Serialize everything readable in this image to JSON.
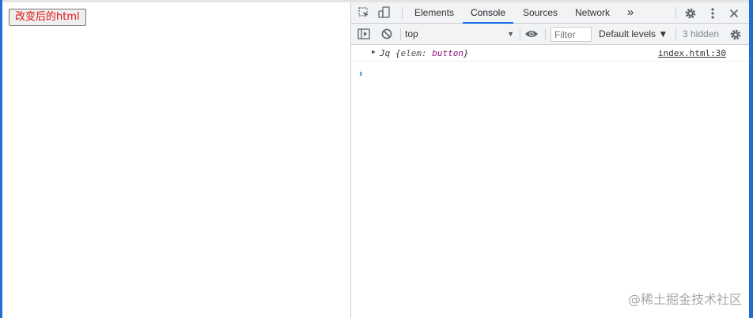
{
  "page": {
    "button_label": "改变后的html"
  },
  "devtools": {
    "tabs": [
      {
        "label": "Elements",
        "active": false
      },
      {
        "label": "Console",
        "active": true
      },
      {
        "label": "Sources",
        "active": false
      },
      {
        "label": "Network",
        "active": false
      }
    ],
    "more_tabs_glyph": "»",
    "toolbar": {
      "context": "top",
      "filter_placeholder": "Filter",
      "levels_label": "Default levels ▼",
      "hidden_label": "3 hidden"
    },
    "console": {
      "log": {
        "class_name": "Jq",
        "key": "elem:",
        "value": "button",
        "source": "index.html:30"
      },
      "prompt_glyph": "›"
    },
    "colors": {
      "accent": "#1a73e8",
      "button_text": "#e01010"
    }
  },
  "watermark": "@稀土掘金技术社区"
}
